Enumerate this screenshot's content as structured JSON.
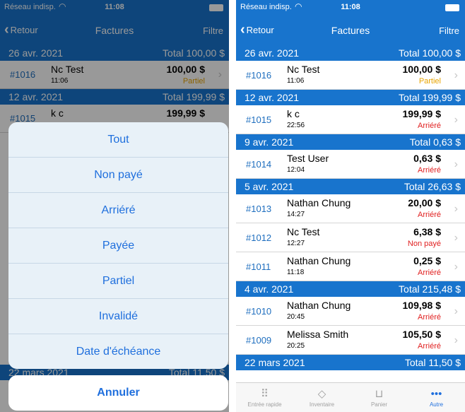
{
  "status_bar": {
    "carrier": "Réseau indisp.",
    "time": "11:08"
  },
  "nav": {
    "back": "Retour",
    "title": "Factures",
    "filter": "Filtre"
  },
  "left_sections": [
    {
      "date": "26 avr. 2021",
      "total": "Total 100,00 $",
      "rows": [
        {
          "number": "#1016",
          "name": "Nc Test",
          "time": "11:06",
          "amount": "100,00 $",
          "status": "Partiel"
        }
      ]
    },
    {
      "date": "12 avr. 2021",
      "total": "Total 199,99 $",
      "rows": [
        {
          "number": "#1015",
          "name": "k c",
          "time": "",
          "amount": "199,99 $",
          "status": ""
        }
      ]
    }
  ],
  "left_bottom_section": {
    "date": "22 mars 2021",
    "total": "Total 11,50 $"
  },
  "action_sheet": {
    "options": [
      "Tout",
      "Non payé",
      "Arriéré",
      "Payée",
      "Partiel",
      "Invalidé",
      "Date d'échéance"
    ],
    "cancel": "Annuler"
  },
  "sections": [
    {
      "date": "26 avr. 2021",
      "total": "Total 100,00 $",
      "rows": [
        {
          "number": "#1016",
          "name": "Nc Test",
          "time": "11:06",
          "amount": "100,00 $",
          "status": "Partiel",
          "status_type": "partial"
        }
      ]
    },
    {
      "date": "12 avr. 2021",
      "total": "Total 199,99 $",
      "rows": [
        {
          "number": "#1015",
          "name": "k c",
          "time": "22:56",
          "amount": "199,99 $",
          "status": "Arriéré",
          "status_type": "overdue"
        }
      ]
    },
    {
      "date": "9 avr. 2021",
      "total": "Total 0,63 $",
      "rows": [
        {
          "number": "#1014",
          "name": "Test  User",
          "time": "12:04",
          "amount": "0,63 $",
          "status": "Arriéré",
          "status_type": "overdue"
        }
      ]
    },
    {
      "date": "5 avr. 2021",
      "total": "Total 26,63 $",
      "rows": [
        {
          "number": "#1013",
          "name": "Nathan Chung",
          "time": "14:27",
          "amount": "20,00 $",
          "status": "Arriéré",
          "status_type": "overdue"
        },
        {
          "number": "#1012",
          "name": "Nc Test",
          "time": "12:27",
          "amount": "6,38 $",
          "status": "Non payé",
          "status_type": "unpaid"
        },
        {
          "number": "#1011",
          "name": "Nathan Chung",
          "time": "11:18",
          "amount": "0,25 $",
          "status": "Arriéré",
          "status_type": "overdue"
        }
      ]
    },
    {
      "date": "4 avr. 2021",
      "total": "Total 215,48 $",
      "rows": [
        {
          "number": "#1010",
          "name": "Nathan Chung",
          "time": "20:45",
          "amount": "109,98 $",
          "status": "Arriéré",
          "status_type": "overdue"
        },
        {
          "number": "#1009",
          "name": "Melissa Smith",
          "time": "20:25",
          "amount": "105,50 $",
          "status": "Arriéré",
          "status_type": "overdue"
        }
      ]
    },
    {
      "date": "22 mars 2021",
      "total": "Total 11,50 $",
      "rows": []
    }
  ],
  "tabs": [
    {
      "label": "Entrée rapide",
      "icon": "grid-icon",
      "active": false
    },
    {
      "label": "Inventaire",
      "icon": "tag-icon",
      "active": false
    },
    {
      "label": "Panier",
      "icon": "cart-icon",
      "active": false
    },
    {
      "label": "Autre",
      "icon": "more-icon",
      "active": true
    }
  ],
  "colors": {
    "accent": "#1874cd",
    "link": "#1f6fdd",
    "overdue": "#e01e1e",
    "partial": "#e8a400"
  }
}
